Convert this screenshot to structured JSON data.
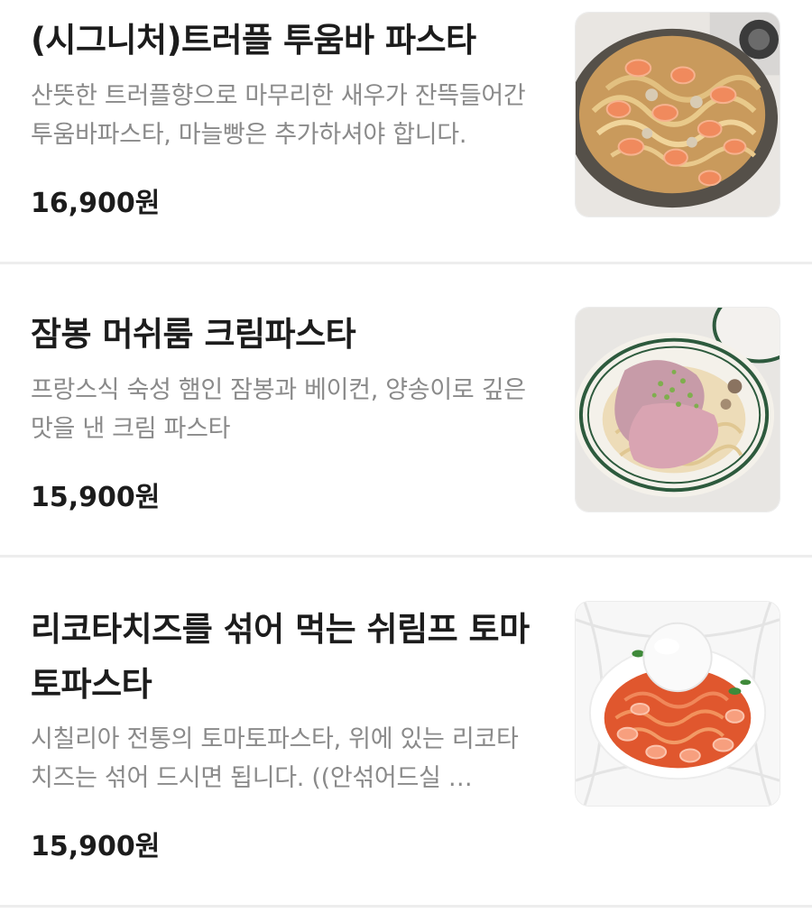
{
  "menu": {
    "items": [
      {
        "name": "(시그니처)트러플 투움바 파스타",
        "description": "산뜻한 트러플향으로 마무리한 새우가 잔뜩들어간 투움바파스타, 마늘빵은 추가하셔야 합니다.",
        "price": "16,900원",
        "image_subject": "truffle tuumba pasta with shrimp in a skillet"
      },
      {
        "name": "잠봉 머쉬룸 크림파스타",
        "description": "프랑스식 숙성 햄인 잠봉과 베이컨, 양송이로 깊은 맛을 낸 크림 파스타",
        "price": "15,900원",
        "image_subject": "jambon mushroom cream pasta on an oval plate"
      },
      {
        "name": "리코타치즈를 섞어 먹는 쉬림프 토마토파스타",
        "description": "시칠리아 전통의 토마토파스타, 위에 있는 리코타치즈는 섞어 드시면 됩니다. ((안섞어드실 …",
        "price": "15,900원",
        "image_subject": "shrimp tomato pasta topped with ricotta cheese"
      }
    ]
  }
}
